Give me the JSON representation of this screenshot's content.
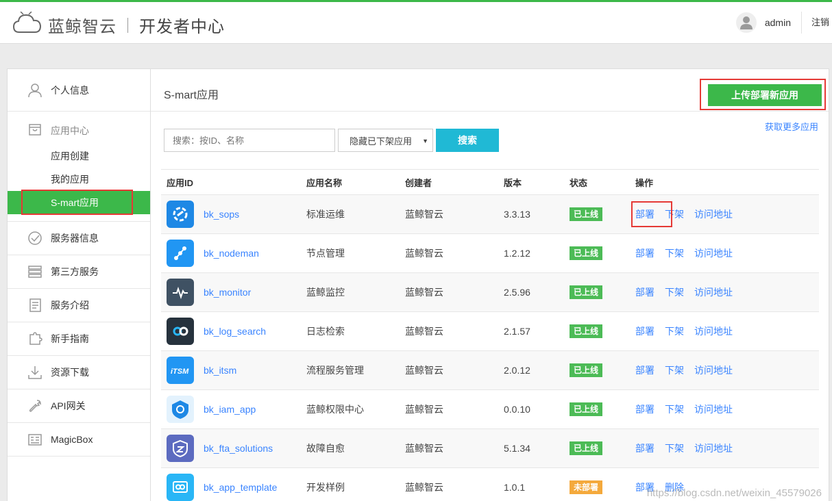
{
  "header": {
    "brand": "蓝鲸智云",
    "section": "开发者中心",
    "username": "admin",
    "logout": "注销"
  },
  "sidebar": {
    "items": [
      {
        "label": "个人信息",
        "icon": "user-icon"
      },
      {
        "label": "服务器信息",
        "icon": "check-circle-icon"
      },
      {
        "label": "第三方服务",
        "icon": "server-icon"
      },
      {
        "label": "服务介绍",
        "icon": "document-icon"
      },
      {
        "label": "新手指南",
        "icon": "puzzle-icon"
      },
      {
        "label": "资源下载",
        "icon": "download-icon"
      },
      {
        "label": "API网关",
        "icon": "wrench-icon"
      },
      {
        "label": "MagicBox",
        "icon": "box-icon"
      }
    ],
    "app_center": {
      "label": "应用中心",
      "sub": [
        "应用创建",
        "我的应用",
        "S-mart应用"
      ]
    }
  },
  "main": {
    "title": "S-mart应用",
    "upload_btn": "上传部署新应用",
    "more_link": "获取更多应用",
    "search_placeholder": "搜索：按ID、名称",
    "filter_value": "隐藏已下架应用",
    "search_btn": "搜索",
    "columns": [
      "应用ID",
      "应用名称",
      "创建者",
      "版本",
      "状态",
      "操作"
    ],
    "rows": [
      {
        "id": "bk_sops",
        "name": "标准运维",
        "creator": "蓝鲸智云",
        "version": "3.3.13",
        "status": "已上线",
        "ops": [
          "部署",
          "下架",
          "访问地址"
        ]
      },
      {
        "id": "bk_nodeman",
        "name": "节点管理",
        "creator": "蓝鲸智云",
        "version": "1.2.12",
        "status": "已上线",
        "ops": [
          "部署",
          "下架",
          "访问地址"
        ]
      },
      {
        "id": "bk_monitor",
        "name": "蓝鲸监控",
        "creator": "蓝鲸智云",
        "version": "2.5.96",
        "status": "已上线",
        "ops": [
          "部署",
          "下架",
          "访问地址"
        ]
      },
      {
        "id": "bk_log_search",
        "name": "日志检索",
        "creator": "蓝鲸智云",
        "version": "2.1.57",
        "status": "已上线",
        "ops": [
          "部署",
          "下架",
          "访问地址"
        ]
      },
      {
        "id": "bk_itsm",
        "name": "流程服务管理",
        "creator": "蓝鲸智云",
        "version": "2.0.12",
        "status": "已上线",
        "ops": [
          "部署",
          "下架",
          "访问地址"
        ]
      },
      {
        "id": "bk_iam_app",
        "name": "蓝鲸权限中心",
        "creator": "蓝鲸智云",
        "version": "0.0.10",
        "status": "已上线",
        "ops": [
          "部署",
          "下架",
          "访问地址"
        ]
      },
      {
        "id": "bk_fta_solutions",
        "name": "故障自愈",
        "creator": "蓝鲸智云",
        "version": "5.1.34",
        "status": "已上线",
        "ops": [
          "部署",
          "下架",
          "访问地址"
        ]
      },
      {
        "id": "bk_app_template",
        "name": "开发样例",
        "creator": "蓝鲸智云",
        "version": "1.0.1",
        "status": "未部署",
        "ops": [
          "部署",
          "删除"
        ]
      }
    ]
  },
  "watermark": "https://blog.csdn.net/weixin_45579026",
  "colors": {
    "accent": "#3cb84a",
    "link": "#3a84ff",
    "search": "#20b9d5",
    "highlight": "#e53935",
    "pending": "#f4a93c"
  }
}
